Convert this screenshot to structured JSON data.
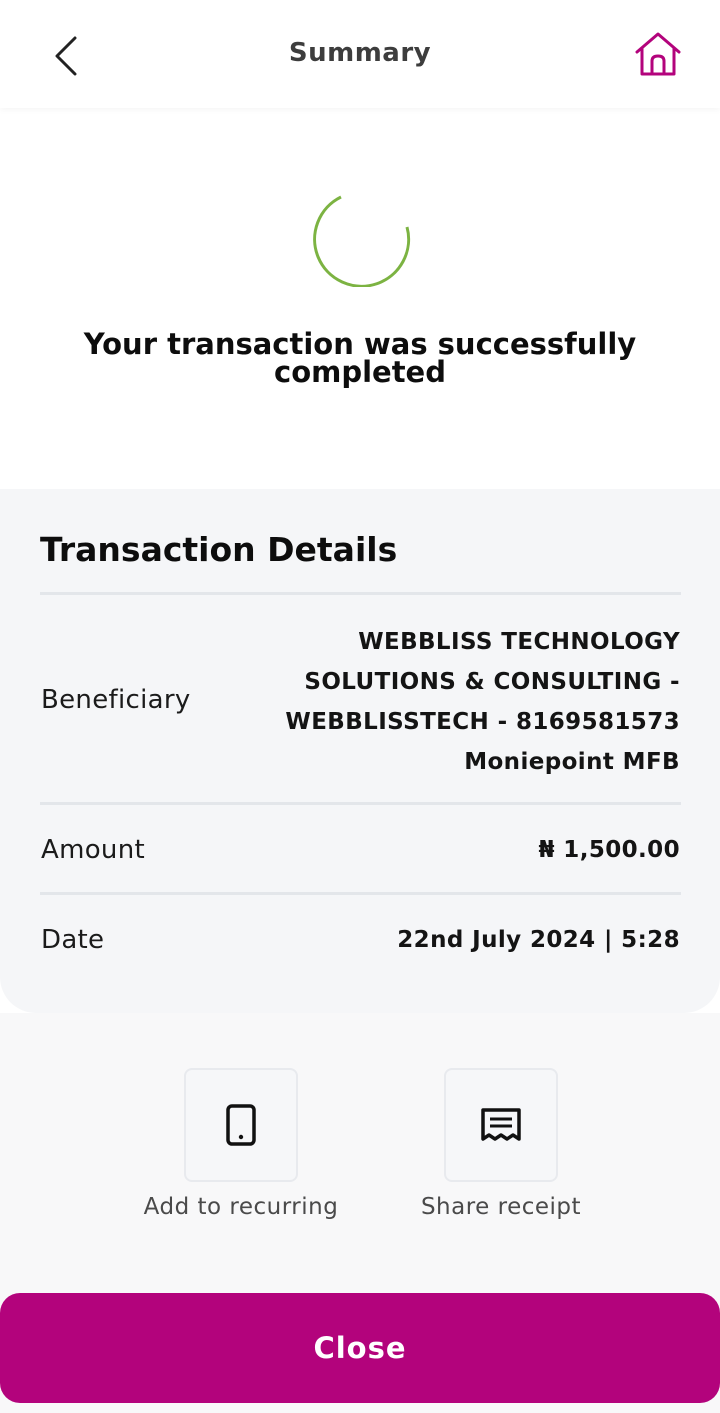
{
  "header": {
    "title": "Summary",
    "back_icon": "chevron-left-icon",
    "home_icon": "home-icon"
  },
  "status": {
    "message": "Your transaction was successfully completed",
    "icon": "loading-spinner-icon"
  },
  "details": {
    "title": "Transaction Details",
    "rows": [
      {
        "label": "Beneficiary",
        "value_lines": [
          "WEBBLISS TECHNOLOGY",
          "SOLUTIONS & CONSULTING -",
          "WEBBLISSTECH - 8169581573",
          "Moniepoint MFB"
        ]
      },
      {
        "label": "Amount",
        "value": "₦ 1,500.00"
      },
      {
        "label": "Date",
        "value": "22nd July 2024 | 5:28"
      }
    ]
  },
  "actions": [
    {
      "label": "Add to recurring",
      "icon": "phone-icon"
    },
    {
      "label": "Share receipt",
      "icon": "receipt-icon"
    }
  ],
  "close_label": "Close",
  "colors": {
    "brand": "#b3037c",
    "spinner": "#7cb342",
    "details_bg": "#f5f6f8"
  }
}
